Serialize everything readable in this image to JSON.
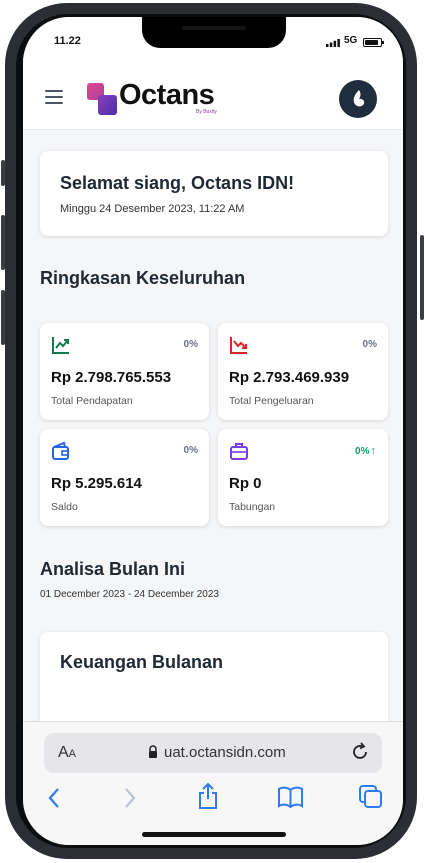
{
  "status_bar": {
    "time": "11.22",
    "network": "5G"
  },
  "app_header": {
    "logo_text": "Octans",
    "logo_subtext": "By Boxity"
  },
  "greeting": {
    "title": "Selamat siang, Octans IDN!",
    "datetime": "Minggu 24 Desember 2023, 11:22 AM"
  },
  "overview": {
    "title": "Ringkasan Keseluruhan",
    "stats": [
      {
        "icon": "trending-up-icon",
        "percent": "0%",
        "value": "Rp 2.798.765.553",
        "label": "Total Pendapatan",
        "color": "#167a4f"
      },
      {
        "icon": "trending-down-icon",
        "percent": "0%",
        "value": "Rp 2.793.469.939",
        "label": "Total Pengeluaran",
        "color": "#dc2626"
      },
      {
        "icon": "wallet-icon",
        "percent": "0%",
        "value": "Rp 5.295.614",
        "label": "Saldo",
        "color": "#2563eb"
      },
      {
        "icon": "briefcase-icon",
        "percent": "0%",
        "value": "Rp 0",
        "label": "Tabungan",
        "color": "#7c3aed"
      }
    ]
  },
  "analysis": {
    "title": "Analisa Bulan Ini",
    "range": "01 December 2023 - 24 December 2023"
  },
  "monthly_card": {
    "title": "Keuangan Bulanan"
  },
  "browser": {
    "text_size": "AA",
    "url": "uat.octansidn.com"
  },
  "colors": {
    "accent_green": "#10a36b",
    "avatar_bg": "#1f2d3d",
    "safari_blue": "#2f7bf6"
  }
}
